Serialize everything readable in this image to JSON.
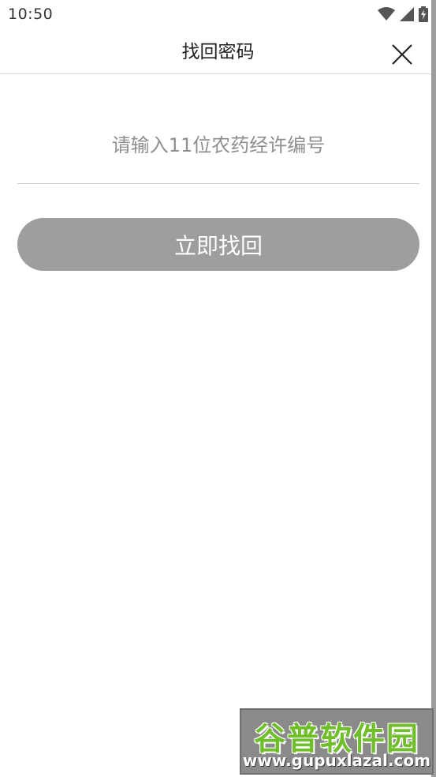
{
  "status_bar": {
    "time": "10:50",
    "icons": [
      "wifi-icon",
      "signal-icon",
      "battery-charging-icon"
    ]
  },
  "header": {
    "title": "找回密码",
    "close_icon": "close-icon"
  },
  "form": {
    "license_input": {
      "value": "",
      "placeholder": "请输入11位农药经许编号"
    },
    "submit_label": "立即找回"
  },
  "colors": {
    "button_bg": "#9e9e9e",
    "divider": "#cccccc",
    "placeholder": "#8f8f8f"
  },
  "watermark": {
    "title": "谷普软件园",
    "url": "www.gupuxlazal.com"
  }
}
